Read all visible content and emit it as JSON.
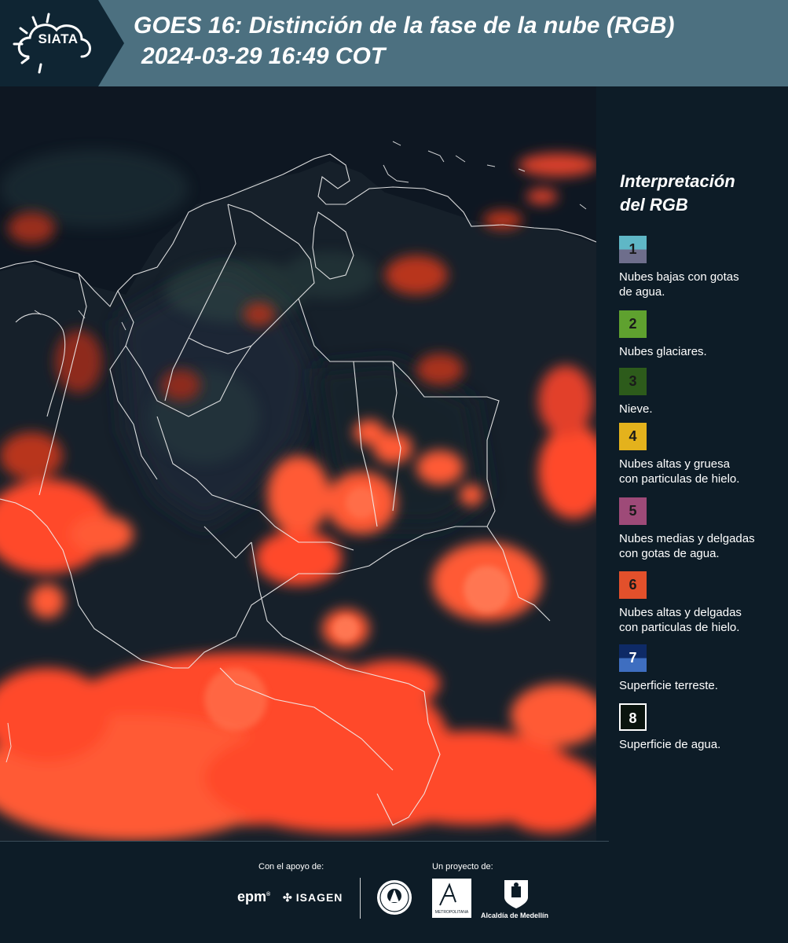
{
  "header": {
    "logo_text": "SIATA",
    "title_line1": "GOES 16: Distinción de la fase de la nube (RGB)",
    "title_line2": "2024-03-29 16:49 COT"
  },
  "legend": {
    "title_line1": "Interpretación",
    "title_line2": "del RGB",
    "items": [
      {
        "number": "1",
        "label_line1": "Nubes bajas con gotas",
        "label_line2": "de agua.",
        "color_top": "#5fb7c6",
        "color_bottom": "#6e6e8c"
      },
      {
        "number": "2",
        "label_line1": "Nubes glaciares.",
        "label_line2": "",
        "color_top": "#5fa12f",
        "color_bottom": "#5fa12f"
      },
      {
        "number": "3",
        "label_line1": "Nieve.",
        "label_line2": "",
        "color_top": "#2d5b1b",
        "color_bottom": "#2d5b1b"
      },
      {
        "number": "4",
        "label_line1": "Nubes altas y gruesa",
        "label_line2": "con particulas de hielo.",
        "color_top": "#e4b21c",
        "color_bottom": "#e4b21c"
      },
      {
        "number": "5",
        "label_line1": "Nubes medias y delgadas",
        "label_line2": "con gotas de agua.",
        "color_top": "#9e4a78",
        "color_bottom": "#9e4a78"
      },
      {
        "number": "6",
        "label_line1": "Nubes altas y delgadas",
        "label_line2": "con particulas de hielo.",
        "color_top": "#e2502b",
        "color_bottom": "#e2502b"
      },
      {
        "number": "7",
        "label_line1": "Superficie terreste.",
        "label_line2": "",
        "color_top": "#0e2a66",
        "color_bottom": "#3e6ec0"
      },
      {
        "number": "8",
        "label_line1": "Superficie de agua.",
        "label_line2": "",
        "color_top": "#0a140e",
        "color_bottom": "#0a140e"
      }
    ]
  },
  "footer": {
    "support_label": "Con el apoyo de:",
    "project_label": "Un proyecto de:",
    "sponsor1": "epm",
    "sponsor2": "ISAGEN",
    "area_logo_text": "METROPOLITANA",
    "alcaldia_text": "Alcaldía de Medellín"
  },
  "colors": {
    "header_bg": "#4c7080",
    "logo_bg": "#0f2533",
    "panel_bg": "#0d1c27",
    "cloud_red": "#ff4a2a",
    "cloud_orange": "#ff7a55"
  }
}
